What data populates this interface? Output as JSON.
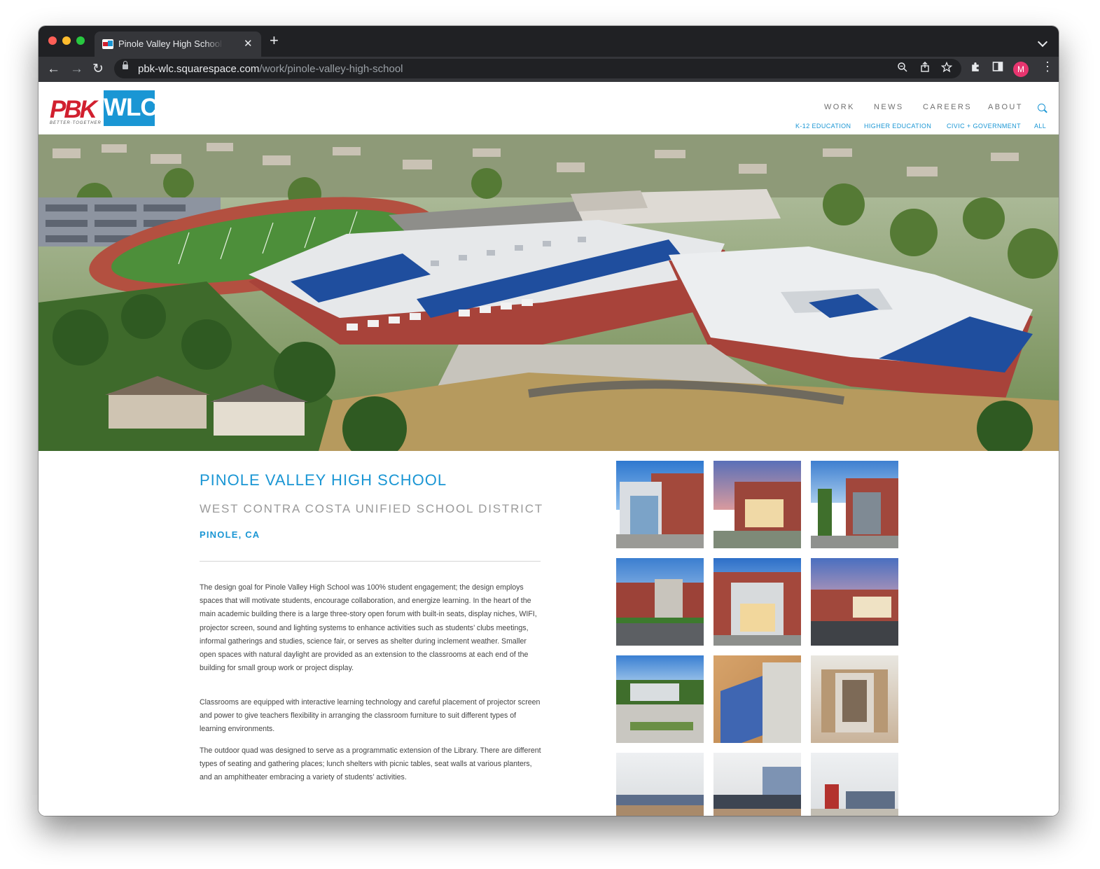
{
  "browser": {
    "tab_title": "Pinole Valley High School | PBK",
    "close_glyph": "✕",
    "newtab_glyph": "+",
    "url_host": "pbk-wlc.squarespace.com",
    "url_path": "/work/pinole-valley-high-school",
    "avatar_letter": "M",
    "colors": {
      "tabbar": "#202124",
      "toolbar": "#35363a",
      "avatar": "#e8356f"
    }
  },
  "site": {
    "logo": {
      "left": "PBK",
      "right": "WLC",
      "tagline": "BETTER·TOGETHER"
    },
    "nav": [
      "WORK",
      "NEWS",
      "CAREERS",
      "ABOUT"
    ],
    "subnav": [
      "K-12 EDUCATION",
      "HIGHER EDUCATION",
      "CIVIC + GOVERNMENT",
      "ALL"
    ],
    "colors": {
      "accent": "#1a96d4",
      "brand_red": "#d1202f"
    }
  },
  "hero": {
    "subject": "aerial view of campus",
    "icon": "hero-image"
  },
  "project": {
    "title": "PINOLE VALLEY HIGH SCHOOL",
    "client": "WEST CONTRA COSTA UNIFIED SCHOOL DISTRICT",
    "location": "PINOLE, CA",
    "paragraphs": [
      "The design goal for Pinole Valley High School was 100% student engagement; the design employs spaces that will motivate students, encourage collaboration, and energize learning. In the heart of the main academic building there is a large three-story open forum with built-in seats, display niches, WIFI, projector screen, sound and lighting systems to enhance activities such as students’ clubs meetings, informal gatherings and studies, science fair, or serves as shelter during inclement weather. Smaller open spaces with natural daylight are provided as an extension to the classrooms at each end of the building for small group work or project display.",
      "Classrooms are equipped with interactive learning technology and careful placement of projector screen and power to give teachers flexibility in arranging the classroom furniture to suit different types of learning environments.",
      "The outdoor quad was designed to serve as a programmatic extension of the Library. There are different types of seating and gathering places; lunch shelters with picnic tables, seat walls at various planters, and an amphitheater embracing a variety of students’ activities."
    ]
  },
  "gallery": [
    "exterior-glass-corner",
    "exterior-entry-dusk",
    "exterior-sign-palms",
    "exterior-arches-palms",
    "exterior-main-entry",
    "exterior-parking-dusk",
    "outdoor-quad",
    "interior-stair-wood",
    "interior-atrium",
    "classroom-1",
    "classroom-2",
    "classroom-3"
  ]
}
